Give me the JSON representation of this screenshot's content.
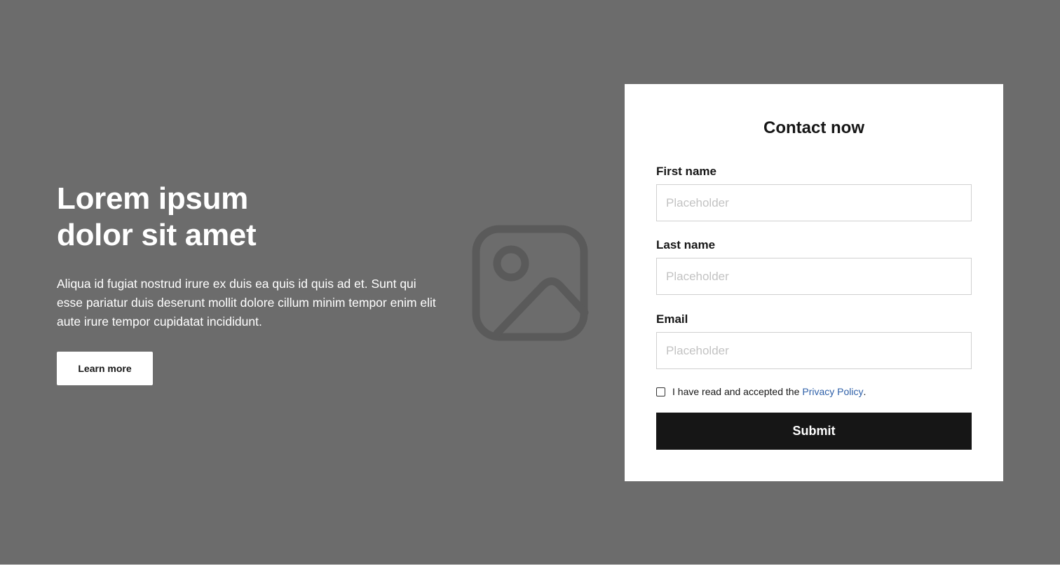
{
  "hero": {
    "headline": "Lorem ipsum\ndolor sit amet",
    "description": "Aliqua id fugiat nostrud irure ex duis ea quis id quis ad et. Sunt qui esse pariatur duis deserunt mollit dolore cillum minim tempor enim elit aute irure tempor cupidatat incididunt.",
    "button_label": "Learn more",
    "image_icon": "image-placeholder-icon"
  },
  "contact_form": {
    "title": "Contact now",
    "fields": [
      {
        "label": "First name",
        "placeholder": "Placeholder",
        "value": ""
      },
      {
        "label": "Last name",
        "placeholder": "Placeholder",
        "value": ""
      },
      {
        "label": "Email",
        "placeholder": "Placeholder",
        "value": ""
      }
    ],
    "privacy": {
      "text": "I have read and accepted the",
      "link_text": "Privacy Policy",
      "suffix": ".",
      "checked": false
    },
    "submit_label": "Submit"
  },
  "colors": {
    "background": "#6c6c6c",
    "card": "#ffffff",
    "primary_button": "#161616",
    "link": "#2d5fa8",
    "input_border": "#d0d0d0",
    "placeholder_text": "#c3c3c3",
    "icon": "#5a5a5a"
  }
}
